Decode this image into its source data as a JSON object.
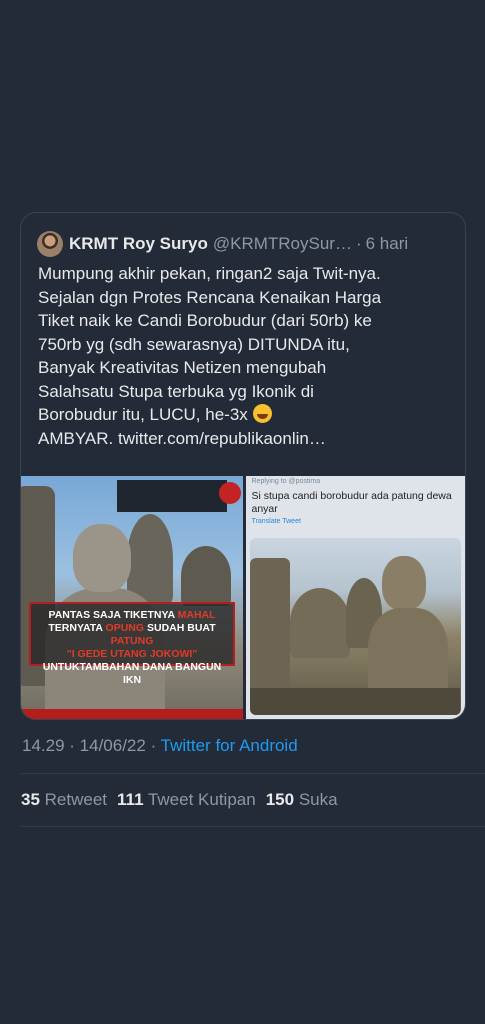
{
  "tweet": {
    "author": {
      "name": "KRMT Roy Suryo",
      "handle": "@KRMTRoySur…",
      "separator": "·",
      "time": "6 hari"
    },
    "text_lines": [
      "Mumpung akhir pekan, ringan2 saja Twit-nya.",
      "Sejalan dgn Protes Rencana Kenaikan Harga",
      "Tiket naik ke Candi Borobudur (dari 50rb) ke",
      "750rb yg (sdh sewarasnya) DITUNDA itu,",
      "Banyak Kreativitas Netizen mengubah",
      "Salahsatu Stupa terbuka yg Ikonik di",
      "Borobudur itu, LUCU, he-3x",
      "AMBYAR. twitter.com/republikaonlin…"
    ],
    "emoji": "rolling-on-floor-laughing",
    "media": {
      "left": {
        "meme_line1_a": "PANTAS SAJA TIKETNYA ",
        "meme_line1_b": "MAHAL",
        "meme_line2_a": "TERNYATA ",
        "meme_line2_b": "OPUNG",
        "meme_line2_c": " SUDAH BUAT ",
        "meme_line2_d": "PATUNG",
        "meme_line3": "\"I GEDE UTANG JOKOWI\"",
        "meme_line4": "UNTUKTAMBAHAN DANA BANGUN IKN"
      },
      "right": {
        "replying": "Replying to @postima",
        "text": "Si stupa candi borobudur ada patung dewa anyar",
        "translate": "Translate Tweet"
      }
    }
  },
  "meta": {
    "time": "14.29",
    "dot1": " · ",
    "date": "14/06/22",
    "dot2": " · ",
    "source": "Twitter for Android"
  },
  "stats": {
    "retweets": "35",
    "retweets_label": "Retweet",
    "quotes": "111",
    "quotes_label": "Tweet Kutipan",
    "likes": "150",
    "likes_label": "Suka"
  },
  "colors": {
    "background": "#242b38",
    "link": "#1d9bf0",
    "secondary_text": "#8b98a5"
  }
}
